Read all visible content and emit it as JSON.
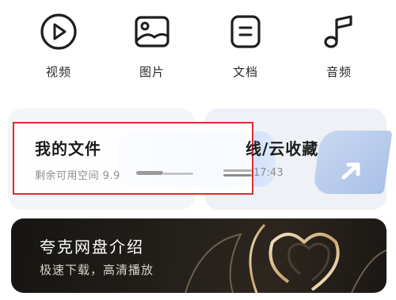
{
  "categories": [
    {
      "label": "视频",
      "icon": "video-play-icon"
    },
    {
      "label": "图片",
      "icon": "image-icon"
    },
    {
      "label": "文档",
      "icon": "document-icon"
    },
    {
      "label": "音频",
      "icon": "music-note-icon"
    }
  ],
  "my_files": {
    "title": "我的文件",
    "subtitle": "剩余可用空间 9.9"
  },
  "favorites": {
    "title": "线/云收藏",
    "subtitle": "17:43"
  },
  "banner": {
    "title": "夸克网盘介绍",
    "subtitle": "极速下载，高清播放"
  },
  "colors": {
    "highlight": "#d92d33",
    "banner_bg": "#1f1b17",
    "accent_gold": "#c9a46a"
  }
}
